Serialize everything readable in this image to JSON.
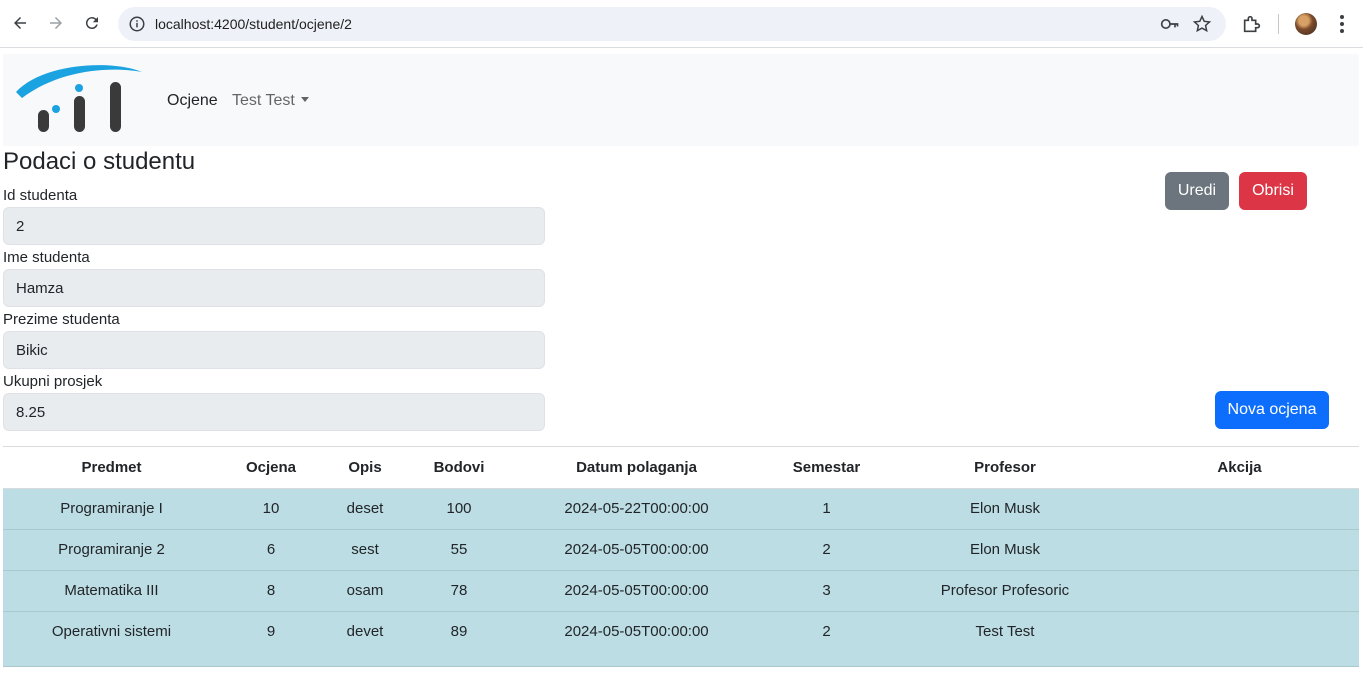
{
  "browser": {
    "url": "localhost:4200/student/ocjene/2"
  },
  "navbar": {
    "link_ocjene": "Ocjene",
    "user_menu": "Test Test"
  },
  "form": {
    "title": "Podaci o studentu",
    "fields": [
      {
        "label": "Id studenta",
        "value": "2"
      },
      {
        "label": "Ime studenta",
        "value": "Hamza"
      },
      {
        "label": "Prezime studenta",
        "value": "Bikic"
      },
      {
        "label": "Ukupni prosjek",
        "value": "8.25"
      }
    ],
    "new_grade_button": "Nova ocjena"
  },
  "table": {
    "headers": [
      "Predmet",
      "Ocjena",
      "Opis",
      "Bodovi",
      "Datum polaganja",
      "Semestar",
      "Profesor",
      "Akcija"
    ],
    "rows": [
      [
        "Programiranje I",
        "10",
        "deset",
        "100",
        "2024-05-22T00:00:00",
        "1",
        "Elon Musk"
      ],
      [
        "Programiranje 2",
        "6",
        "sest",
        "55",
        "2024-05-05T00:00:00",
        "2",
        "Elon Musk"
      ],
      [
        "Matematika III",
        "8",
        "osam",
        "78",
        "2024-05-05T00:00:00",
        "3",
        "Profesor Profesoric"
      ],
      [
        "Operativni sistemi",
        "9",
        "devet",
        "89",
        "2024-05-05T00:00:00",
        "2",
        "Test Test"
      ]
    ],
    "edit_button": "Uredi",
    "delete_button": "Obrisi"
  },
  "colors": {
    "primary": "#0d6efd",
    "secondary": "#6c757d",
    "danger": "#dc3545",
    "row_bg": "#bcdde3",
    "logo_blue": "#1aa3e0",
    "logo_dark": "#3a3a3a"
  }
}
